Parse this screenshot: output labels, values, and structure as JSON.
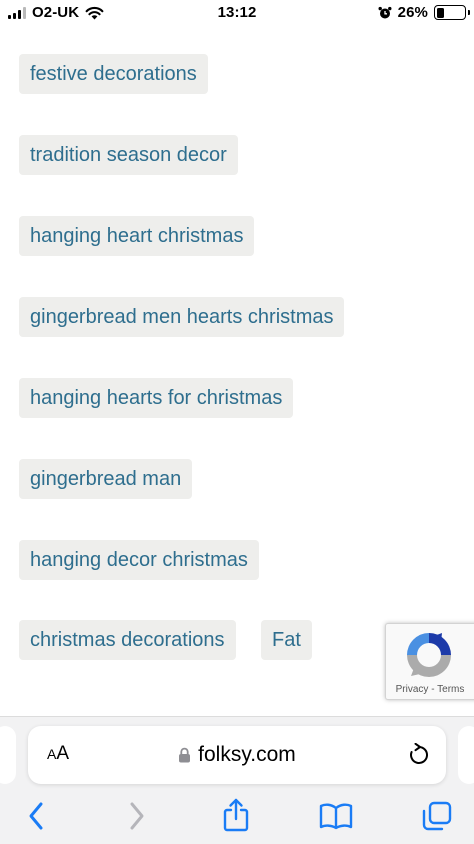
{
  "status_bar": {
    "carrier": "O2-UK",
    "time": "13:12",
    "battery_percent": "26%",
    "battery_level": 0.26,
    "signal_bars": 3,
    "signal_bars_total": 4
  },
  "tags": [
    {
      "label": "festive decorations"
    },
    {
      "label": "tradition season decor"
    },
    {
      "label": "hanging heart christmas"
    },
    {
      "label": "gingerbread men hearts christmas"
    },
    {
      "label": "hanging hearts for christmas"
    },
    {
      "label": "gingerbread man"
    },
    {
      "label": "hanging decor christmas"
    },
    {
      "label": "christmas decorations"
    },
    {
      "label": "Fat"
    }
  ],
  "recaptcha": {
    "privacy": "Privacy",
    "separator": " - ",
    "terms": "Terms"
  },
  "browser": {
    "aa_large": "A",
    "aa_small": "A",
    "url": "folksy.com"
  },
  "colors": {
    "tag_text": "#2e6e8e",
    "tag_background": "#eeeeec",
    "ios_blue": "#1a7cf5"
  },
  "icons": [
    "wifi-icon",
    "alarm-icon",
    "battery-icon",
    "recaptcha-icon",
    "lock-icon",
    "reload-icon",
    "back-icon",
    "forward-icon",
    "share-icon",
    "bookmarks-icon",
    "tabs-icon"
  ]
}
